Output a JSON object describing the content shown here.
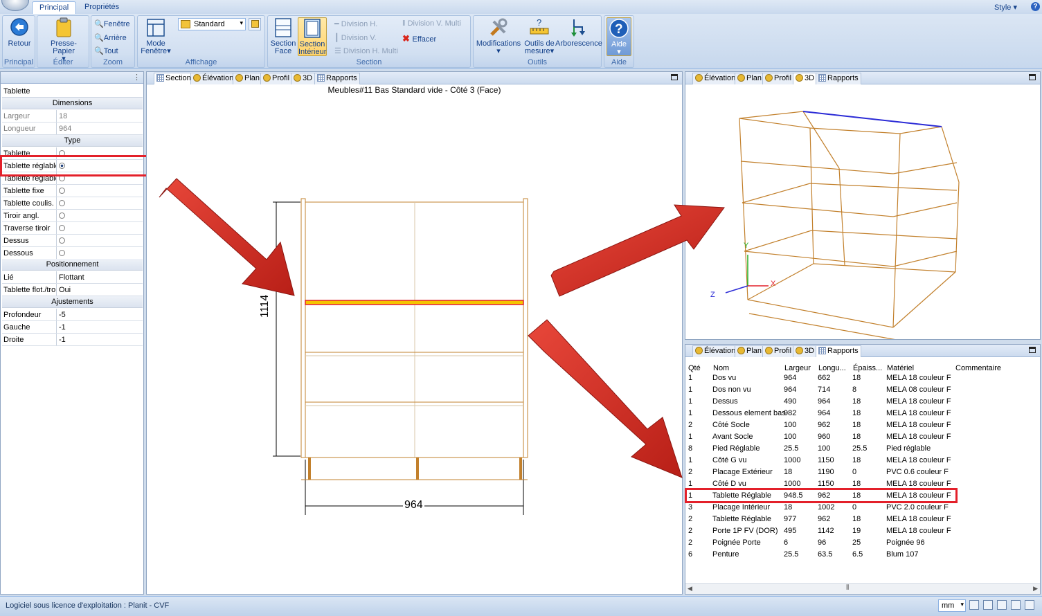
{
  "ribbon": {
    "tabs": [
      "Principal",
      "Propriétés"
    ],
    "style_label": "Style",
    "groups": {
      "principal": {
        "label": "Principal",
        "retour": "Retour"
      },
      "editer": {
        "label": "Éditer",
        "presse": "Presse-Papier"
      },
      "zoom": {
        "label": "Zoom",
        "fenetre": "Fenêtre",
        "arriere": "Arrière",
        "tout": "Tout"
      },
      "affichage": {
        "label": "Affichage",
        "mode1": "Mode",
        "mode2": "Fenêtre",
        "view_select": "Standard"
      },
      "section": {
        "label": "Section",
        "face1": "Section",
        "face2": "Face",
        "int1": "Section",
        "int2": "Intérieur",
        "divh": "Division H.",
        "divv": "Division V.",
        "divhm": "Division H. Multi",
        "divvm": "Division V. Multi",
        "effacer": "Effacer"
      },
      "outils": {
        "label": "Outils",
        "modif": "Modifications",
        "mes1": "Outils de",
        "mes2": "mesure",
        "arbo": "Arborescence"
      },
      "aide": {
        "label": "Aide",
        "aide": "Aide"
      }
    }
  },
  "properties": {
    "title": "Tablette",
    "cat_dimensions": "Dimensions",
    "largeur_k": "Largeur",
    "largeur_v": "18",
    "longueur_k": "Longueur",
    "longueur_v": "964",
    "cat_type": "Type",
    "types": [
      "Tablette",
      "Tablette réglable",
      "Tablette réglable",
      "Tablette fixe",
      "Tablette coulis.",
      "Tiroir angl.",
      "Traverse tiroir",
      "Dessus",
      "Dessous"
    ],
    "cat_pos": "Positionnement",
    "lie_k": "Lié",
    "lie_v": "Flottant",
    "flot_k": "Tablette flot./trou",
    "flot_v": "Oui",
    "cat_aj": "Ajustements",
    "prof_k": "Profondeur",
    "prof_v": "-5",
    "gauche_k": "Gauche",
    "gauche_v": "-1",
    "droite_k": "Droite",
    "droite_v": "-1"
  },
  "center": {
    "tabs": [
      "Section",
      "Élévation",
      "Plan",
      "Profil",
      "3D",
      "Rapports"
    ],
    "title": "Meubles#11 Bas Standard vide - Côté 3 (Face)",
    "dim_height": "1114",
    "dim_width": "964"
  },
  "view3d": {
    "tabs": [
      "Élévation",
      "Plan",
      "Profil",
      "3D",
      "Rapports"
    ],
    "axis_y": "Y",
    "axis_x": "X",
    "axis_z": "Z"
  },
  "report": {
    "tabs": [
      "Élévation",
      "Plan",
      "Profil",
      "3D",
      "Rapports"
    ],
    "headers": [
      "Qté",
      "Nom",
      "Largeur",
      "Longu...",
      "Épaiss...",
      "Matériel",
      "Commentaire"
    ],
    "rows": [
      [
        "1",
        "Dos vu",
        "964",
        "662",
        "18",
        "MELA 18 couleur F"
      ],
      [
        "1",
        "Dos non vu",
        "964",
        "714",
        "8",
        "MELA 08 couleur F"
      ],
      [
        "1",
        "Dessus",
        "490",
        "964",
        "18",
        "MELA 18 couleur F"
      ],
      [
        "1",
        "Dessous element bas",
        "982",
        "964",
        "18",
        "MELA 18 couleur F"
      ],
      [
        "2",
        "Côté Socle",
        "100",
        "962",
        "18",
        "MELA 18 couleur F"
      ],
      [
        "1",
        "Avant Socle",
        "100",
        "960",
        "18",
        "MELA 18 couleur F"
      ],
      [
        "8",
        "Pied Réglable",
        "25.5",
        "100",
        "25.5",
        "Pied réglable"
      ],
      [
        "1",
        "Côté G vu",
        "1000",
        "1150",
        "18",
        "MELA 18 couleur F"
      ],
      [
        "2",
        "Placage Extérieur",
        "18",
        "1190",
        "0",
        "PVC 0.6 couleur F"
      ],
      [
        "1",
        "Côté D vu",
        "1000",
        "1150",
        "18",
        "MELA 18 couleur F"
      ],
      [
        "1",
        "Tablette Réglable",
        "948.5",
        "962",
        "18",
        "MELA 18 couleur F"
      ],
      [
        "3",
        "Placage Intérieur",
        "18",
        "1002",
        "0",
        "PVC 2.0 couleur F"
      ],
      [
        "2",
        "Tablette Réglable",
        "977",
        "962",
        "18",
        "MELA 18 couleur F"
      ],
      [
        "2",
        "Porte 1P FV (DOR)",
        "495",
        "1142",
        "19",
        "MELA 18 couleur F"
      ],
      [
        "2",
        "Poignée Porte",
        "6",
        "96",
        "25",
        "Poignée 96"
      ],
      [
        "6",
        "Penture",
        "25.5",
        "63.5",
        "6.5",
        "Blum 107"
      ]
    ]
  },
  "status": {
    "text": "Logiciel sous licence d'exploitation : Planit - CVF",
    "unit": "mm"
  },
  "colors": {
    "highlight": "#e3202a",
    "arrow": "#d42a1f",
    "shelf": "#f5c400",
    "wood": "#c2802c"
  }
}
